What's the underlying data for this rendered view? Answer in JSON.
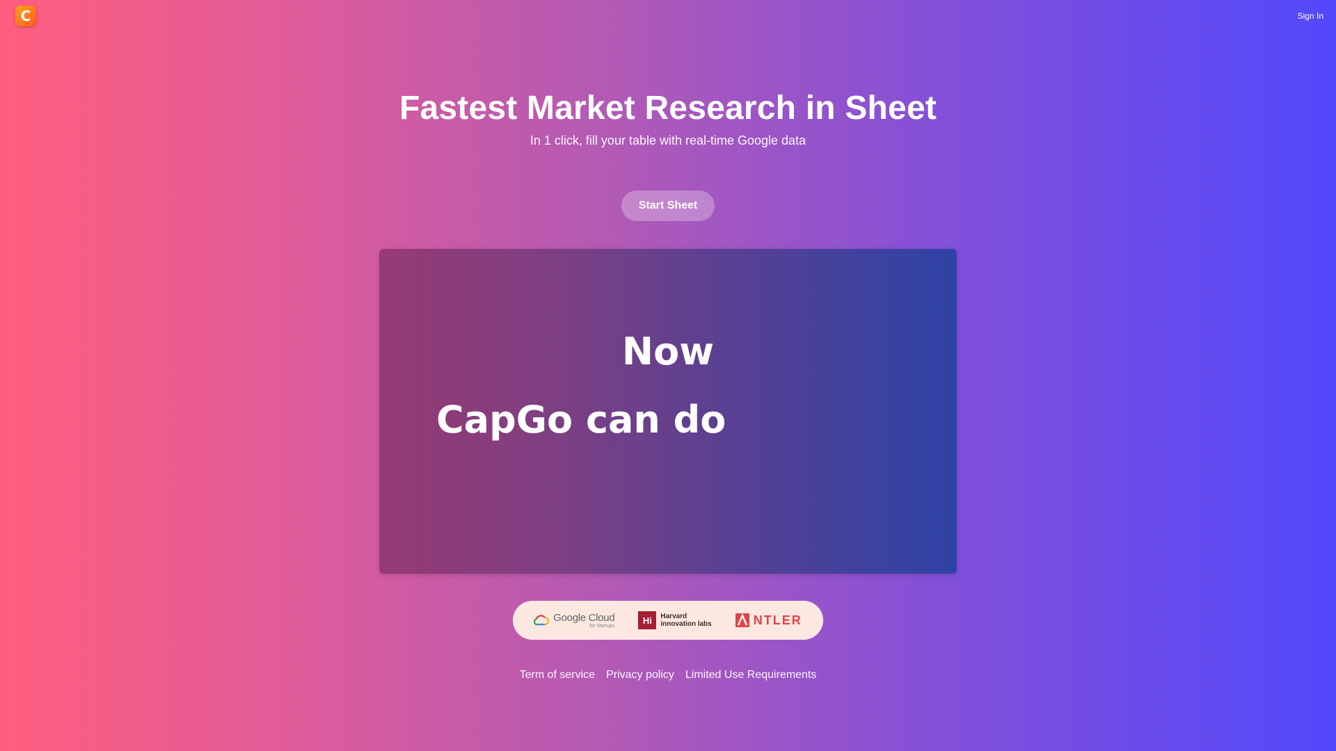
{
  "header": {
    "logo_letter": "C",
    "sign_in_label": "Sign In"
  },
  "hero": {
    "title": "Fastest Market Research in Sheet",
    "subtitle": "In 1 click, fill your table with real-time Google data",
    "cta_label": "Start Sheet"
  },
  "video": {
    "line1": "Now",
    "line2": "CapGo can do"
  },
  "partners": {
    "google_cloud": {
      "name": "Google Cloud",
      "sub": "for Startups"
    },
    "harvard": {
      "mark": "Hi",
      "line1": "Harvard",
      "line2": "innovation labs"
    },
    "antler": {
      "name": "NTLER"
    }
  },
  "footer": {
    "links": [
      "Term of service",
      "Privacy policy",
      "Limited Use Requirements"
    ]
  },
  "colors": {
    "gradient_start": "#ff5e7e",
    "gradient_end": "#5248fb",
    "logo": "#ff7a1a",
    "partners_bg": "#fde8e1",
    "harvard_red": "#a41e34",
    "antler_red": "#e2424a"
  }
}
